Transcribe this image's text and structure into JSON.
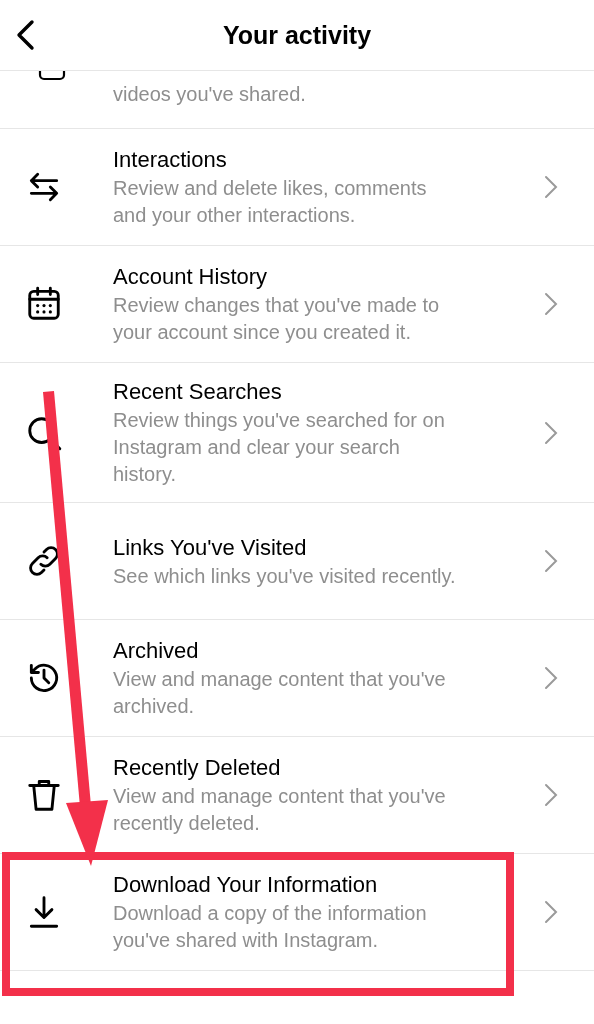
{
  "header": {
    "title": "Your activity"
  },
  "partial_item": {
    "description": "videos you've shared."
  },
  "items": [
    {
      "kind": "interactions",
      "title": "Interactions",
      "description": "Review and delete likes, comments and your other interactions.",
      "highlighted": false
    },
    {
      "kind": "calendar",
      "title": "Account History",
      "description": "Review changes that you've made to your account since you created it.",
      "highlighted": false
    },
    {
      "kind": "search",
      "title": "Recent Searches",
      "description": "Review things you've searched for on Instagram and clear your search history.",
      "highlighted": false
    },
    {
      "kind": "link",
      "title": "Links You've Visited",
      "description": "See which links you've visited recently.",
      "highlighted": false
    },
    {
      "kind": "archive",
      "title": "Archived",
      "description": "View and manage content that you've archived.",
      "highlighted": false
    },
    {
      "kind": "trash",
      "title": "Recently Deleted",
      "description": "View and manage content that you've recently deleted.",
      "highlighted": false
    },
    {
      "kind": "download",
      "title": "Download Your Information",
      "description": "Download a copy of the information you've shared with Instagram.",
      "highlighted": true
    }
  ]
}
